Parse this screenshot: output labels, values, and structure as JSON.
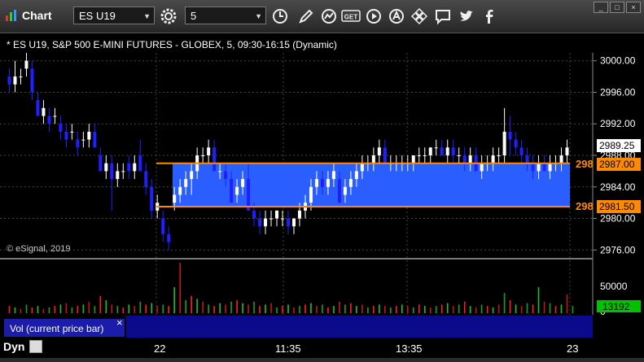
{
  "toolbar": {
    "title": "Chart",
    "symbol": "ES U19",
    "interval": "5",
    "icons": [
      "gear-icon",
      "clock-icon",
      "pencil-icon",
      "study-icon",
      "get-icon",
      "play-icon",
      "alert-icon",
      "move-icon",
      "comment-icon",
      "twitter-icon",
      "facebook-icon"
    ]
  },
  "chart": {
    "header": "* ES U19, S&P 500 E-MINI FUTURES - GLOBEX, 5, 09:30-16:15 (Dynamic)",
    "copyright": "© eSignal, 2019",
    "colors": {
      "up": "#ffffff",
      "down": "#2020ff",
      "band": "#2a5eff",
      "line": "#ff8a00",
      "price_label": "#ffffff",
      "vol_label": "#00c000"
    },
    "price_ticks": [
      "3000.00",
      "2996.00",
      "2992.00",
      "2988.00",
      "2984.00",
      "2980.00",
      "2976.00"
    ],
    "current_price": "2989.25",
    "upper_line": {
      "value": "2987.00",
      "partial": "298"
    },
    "lower_line": {
      "value": "2981.50",
      "partial": "298"
    },
    "vol_ticks": [
      "50000",
      "0"
    ],
    "vol_current": "13192",
    "vol_label": "Vol (current price bar)",
    "close_x": "×",
    "time_labels": [
      "22",
      "11:35",
      "13:35",
      "23"
    ],
    "status_text": "Dyn"
  },
  "chart_data": {
    "type": "candlestick",
    "ylim": [
      2975,
      3001
    ],
    "lines": [
      2987.0,
      2981.5
    ],
    "bars": [
      [
        2998,
        2999,
        2996,
        2997
      ],
      [
        2997,
        3000,
        2996,
        2998
      ],
      [
        2998,
        2999,
        2997,
        2998
      ],
      [
        2999,
        3001,
        2998,
        3000
      ],
      [
        2999,
        3000,
        2995,
        2996
      ],
      [
        2995,
        2996,
        2993,
        2993
      ],
      [
        2993,
        2995,
        2992,
        2994
      ],
      [
        2993,
        2994,
        2991,
        2992
      ],
      [
        2993,
        2994,
        2992,
        2993
      ],
      [
        2992,
        2993,
        2990,
        2991
      ],
      [
        2991,
        2992,
        2989,
        2990
      ],
      [
        2991,
        2992,
        2990,
        2991
      ],
      [
        2990,
        2991,
        2988,
        2989
      ],
      [
        2990,
        2991,
        2989,
        2990
      ],
      [
        2990,
        2992,
        2989,
        2991
      ],
      [
        2991,
        2992,
        2989,
        2989
      ],
      [
        2988,
        2989,
        2986,
        2986
      ],
      [
        2986,
        2988,
        2985,
        2987
      ],
      [
        2987,
        2988,
        2981,
        2985
      ],
      [
        2985,
        2987,
        2984,
        2986
      ],
      [
        2986,
        2987,
        2985,
        2986
      ],
      [
        2987,
        2988,
        2985,
        2986
      ],
      [
        2986,
        2988,
        2985,
        2987
      ],
      [
        2988,
        2990,
        2986,
        2986
      ],
      [
        2986,
        2987,
        2983,
        2984
      ],
      [
        2984,
        2985,
        2980,
        2981
      ],
      [
        2981,
        2983,
        2980,
        2982
      ],
      [
        2980,
        2981,
        2977,
        2978
      ],
      [
        2978,
        2979,
        2976,
        2977
      ],
      [
        2982,
        2984,
        2981,
        2983
      ],
      [
        2983,
        2985,
        2982,
        2984
      ],
      [
        2984,
        2986,
        2983,
        2985
      ],
      [
        2985,
        2987,
        2983,
        2986
      ],
      [
        2986,
        2989,
        2985,
        2988
      ],
      [
        2988,
        2989,
        2987,
        2988
      ],
      [
        2988,
        2990,
        2987,
        2989
      ],
      [
        2989,
        2990,
        2986,
        2986
      ],
      [
        2986,
        2987,
        2985,
        2986
      ],
      [
        2986,
        2987,
        2984,
        2985
      ],
      [
        2985,
        2986,
        2982,
        2982
      ],
      [
        2983,
        2985,
        2982,
        2984
      ],
      [
        2984,
        2986,
        2983,
        2985
      ],
      [
        2985,
        2987,
        2981,
        2981
      ],
      [
        2981,
        2982,
        2979,
        2980
      ],
      [
        2980,
        2981,
        2978,
        2979
      ],
      [
        2979,
        2981,
        2978,
        2980
      ],
      [
        2980,
        2981,
        2979,
        2980
      ],
      [
        2980,
        2981,
        2979,
        2981
      ],
      [
        2980,
        2981,
        2979,
        2980
      ],
      [
        2980,
        2981,
        2978,
        2979
      ],
      [
        2979,
        2980,
        2978,
        2980
      ],
      [
        2980,
        2982,
        2979,
        2981
      ],
      [
        2981,
        2983,
        2980,
        2982
      ],
      [
        2982,
        2985,
        2981,
        2984
      ],
      [
        2984,
        2986,
        2983,
        2985
      ],
      [
        2985,
        2986,
        2983,
        2984
      ],
      [
        2984,
        2986,
        2983,
        2985
      ],
      [
        2985,
        2987,
        2984,
        2986
      ],
      [
        2985,
        2986,
        2982,
        2982
      ],
      [
        2983,
        2985,
        2982,
        2984
      ],
      [
        2984,
        2986,
        2983,
        2985
      ],
      [
        2985,
        2987,
        2984,
        2986
      ],
      [
        2986,
        2988,
        2985,
        2987
      ],
      [
        2987,
        2988,
        2986,
        2987
      ],
      [
        2987,
        2989,
        2986,
        2988
      ],
      [
        2988,
        2990,
        2987,
        2989
      ],
      [
        2989,
        2990,
        2987,
        2987
      ],
      [
        2987,
        2988,
        2986,
        2987
      ],
      [
        2987,
        2988,
        2986,
        2987
      ],
      [
        2987,
        2988,
        2986,
        2987
      ],
      [
        2987,
        2988,
        2986,
        2987
      ],
      [
        2987,
        2988,
        2986,
        2988
      ],
      [
        2988,
        2989,
        2987,
        2988
      ],
      [
        2988,
        2989,
        2987,
        2988
      ],
      [
        2988,
        2989,
        2987,
        2989
      ],
      [
        2989,
        2990,
        2988,
        2989
      ],
      [
        2989,
        2990,
        2988,
        2988
      ],
      [
        2988,
        2990,
        2987,
        2989
      ],
      [
        2989,
        2990,
        2987,
        2988
      ],
      [
        2988,
        2989,
        2987,
        2988
      ],
      [
        2988,
        2989,
        2986,
        2987
      ],
      [
        2987,
        2989,
        2986,
        2988
      ],
      [
        2988,
        2989,
        2986,
        2986
      ],
      [
        2986,
        2988,
        2985,
        2987
      ],
      [
        2987,
        2988,
        2986,
        2987
      ],
      [
        2987,
        2989,
        2986,
        2988
      ],
      [
        2988,
        2989,
        2987,
        2988
      ],
      [
        2988,
        2994,
        2987,
        2991
      ],
      [
        2991,
        2993,
        2988,
        2990
      ],
      [
        2990,
        2991,
        2988,
        2989
      ],
      [
        2989,
        2990,
        2987,
        2988
      ],
      [
        2988,
        2989,
        2986,
        2987
      ],
      [
        2987,
        2988,
        2985,
        2986
      ],
      [
        2986,
        2988,
        2985,
        2987
      ],
      [
        2987,
        2988,
        2986,
        2986
      ],
      [
        2986,
        2988,
        2985,
        2987
      ],
      [
        2987,
        2988,
        2986,
        2987
      ],
      [
        2987,
        2989,
        2986,
        2988
      ],
      [
        2988,
        2990,
        2987,
        2989
      ]
    ],
    "volume": [
      5,
      4,
      3,
      6,
      4,
      5,
      3,
      4,
      5,
      6,
      7,
      4,
      5,
      6,
      8,
      5,
      12,
      9,
      6,
      5,
      4,
      6,
      5,
      8,
      6,
      7,
      5,
      6,
      5,
      18,
      35,
      9,
      12,
      10,
      8,
      6,
      5,
      7,
      6,
      8,
      9,
      7,
      6,
      8,
      5,
      6,
      7,
      4,
      5,
      6,
      4,
      5,
      6,
      7,
      5,
      6,
      4,
      5,
      8,
      6,
      7,
      5,
      6,
      4,
      5,
      6,
      5,
      4,
      5,
      6,
      5,
      4,
      6,
      5,
      4,
      5,
      6,
      7,
      5,
      6,
      8,
      5,
      4,
      6,
      5,
      4,
      6,
      14,
      9,
      6,
      5,
      7,
      6,
      18,
      8,
      7,
      5,
      6,
      13,
      5
    ],
    "vol_spike_index": 29,
    "vol_colors": [
      "#ff2020",
      "#20c020",
      "#c01818",
      "#18a018"
    ]
  }
}
